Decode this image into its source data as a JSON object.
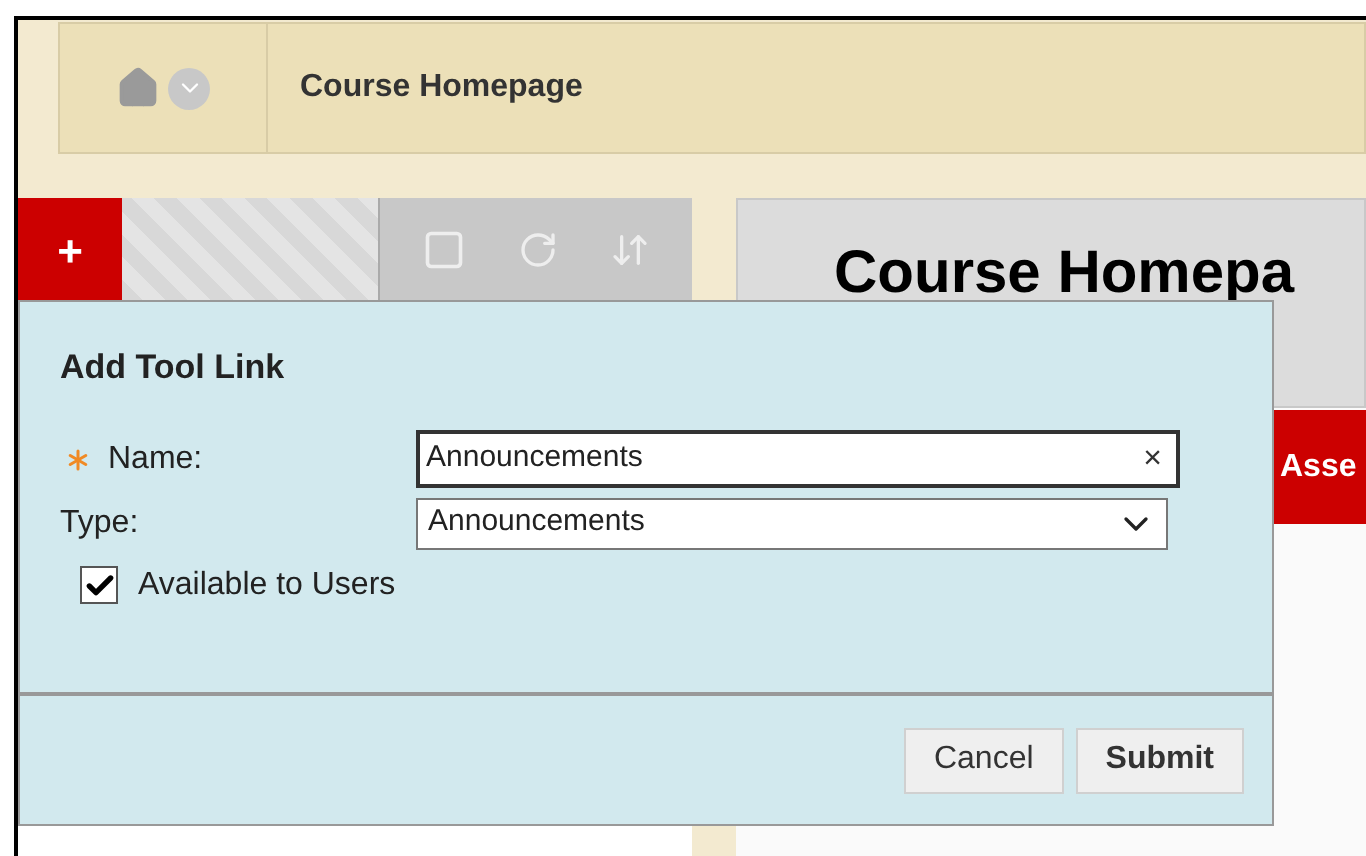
{
  "breadcrumb": {
    "title": "Course Homepage"
  },
  "course_menu": {
    "add_label": "+"
  },
  "content": {
    "heading": "Course Homepa",
    "action_button": "Asse"
  },
  "dialog": {
    "title": "Add Tool Link",
    "fields": [
      {
        "label": "Name:",
        "required": true,
        "kind": "text",
        "value": "Announcements",
        "clear": "×"
      },
      {
        "label": "Type:",
        "required": false,
        "kind": "select",
        "value": "Announcements"
      }
    ],
    "available": {
      "label": "Available to Users",
      "checked": true
    },
    "buttons": [
      {
        "label": "Cancel",
        "primary": false
      },
      {
        "label": "Submit",
        "primary": true
      }
    ]
  }
}
